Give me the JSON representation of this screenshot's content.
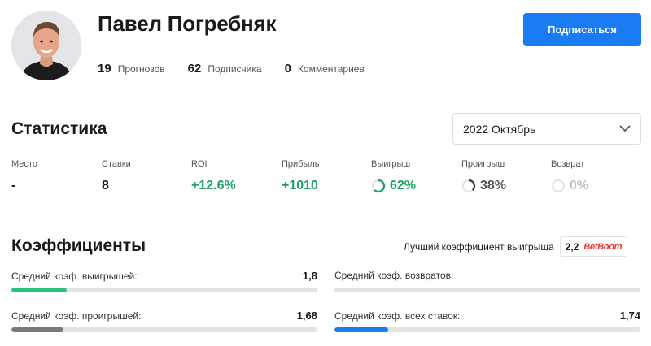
{
  "profile": {
    "name": "Павел Погребняк",
    "counts": [
      {
        "value": "19",
        "label": "Прогнозов"
      },
      {
        "value": "62",
        "label": "Подписчика"
      },
      {
        "value": "0",
        "label": "Комментариев"
      }
    ],
    "subscribe_label": "Подписаться"
  },
  "statistics": {
    "title": "Статистика",
    "period": "2022 Октябрь",
    "items": [
      {
        "label": "Место",
        "value": "-"
      },
      {
        "label": "Ставки",
        "value": "8"
      },
      {
        "label": "ROI",
        "value": "+12.6%"
      },
      {
        "label": "Прибыль",
        "value": "+1010"
      },
      {
        "label": "Выигрыш",
        "value": "62%",
        "percent": 62
      },
      {
        "label": "Проигрыш",
        "value": "38%",
        "percent": 38
      },
      {
        "label": "Возврат",
        "value": "0%",
        "percent": 0
      }
    ]
  },
  "coefficients": {
    "title": "Коэффициенты",
    "best_label": "Лучший коэффициент выигрыша",
    "best_value": "2,2",
    "bookmaker": "BetBoom",
    "items": [
      {
        "label": "Средний коэф. выигрышей:",
        "value": "1,8",
        "fill": 0.18
      },
      {
        "label": "Средний коэф. возвратов:",
        "value": "",
        "fill": 0
      },
      {
        "label": "Средний коэф. проигрышей:",
        "value": "1,68",
        "fill": 0.17
      },
      {
        "label": "Средний коэф. всех ставок:",
        "value": "1,74",
        "fill": 0.175
      }
    ]
  },
  "colors": {
    "accent": "#1a7cf2",
    "positive": "#21a067",
    "win_bar": "#2ac482",
    "loss_bar": "#7a7a7a",
    "all_bar": "#1a7cf2"
  }
}
